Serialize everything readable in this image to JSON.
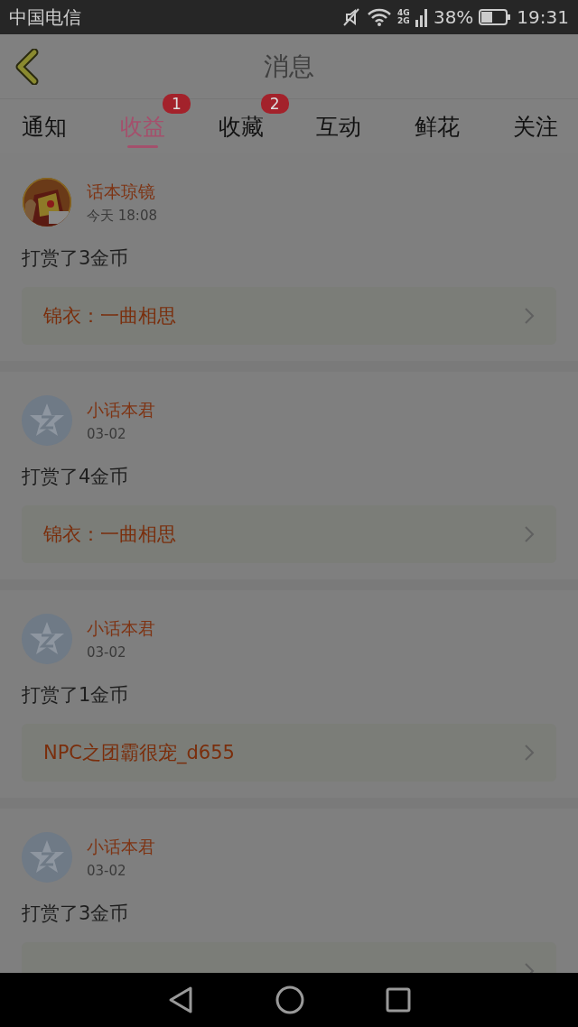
{
  "status_bar": {
    "carrier": "中国电信",
    "network": "4G 2G",
    "battery": "38%",
    "time": "19:31"
  },
  "header": {
    "title": "消息"
  },
  "tabs": [
    {
      "label": "通知",
      "selected": false
    },
    {
      "label": "收益",
      "selected": true,
      "badge": "1"
    },
    {
      "label": "收藏",
      "selected": false,
      "badge": "2"
    },
    {
      "label": "互动",
      "selected": false
    },
    {
      "label": "鲜花",
      "selected": false
    },
    {
      "label": "关注",
      "selected": false
    }
  ],
  "messages": [
    {
      "kind": "picture",
      "sender": "话本琼镜",
      "time": "今天 18:08",
      "text": "打赏了3金币",
      "link": "锦衣：一曲相思"
    },
    {
      "kind": "default",
      "sender": "小话本君",
      "time": "03-02",
      "text": "打赏了4金币",
      "link": "锦衣：一曲相思"
    },
    {
      "kind": "default",
      "sender": "小话本君",
      "time": "03-02",
      "text": "打赏了1金币",
      "link": "NPC之团霸很宠_d655"
    },
    {
      "kind": "default",
      "sender": "小话本君",
      "time": "03-02",
      "text": "打赏了3金币"
    }
  ]
}
